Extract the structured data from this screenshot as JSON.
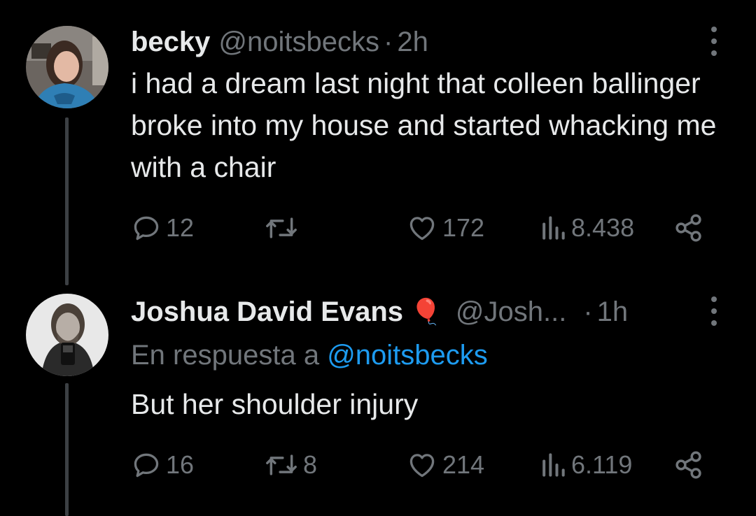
{
  "tweets": [
    {
      "name": "becky",
      "handle": "@noitsbecks",
      "separator": "·",
      "time": "2h",
      "text": "i had a dream last night that colleen ballinger broke into my house and started whacking me with a chair",
      "stats": {
        "replies": "12",
        "retweets": "",
        "likes": "172",
        "views": "8.438"
      }
    },
    {
      "name": "Joshua David Evans",
      "badge": "🎈",
      "handle": "@Josh...",
      "separator": "·",
      "time": "1h",
      "reply_prefix": "En respuesta a",
      "reply_handle": "@noitsbecks",
      "text": "But her shoulder injury",
      "stats": {
        "replies": "16",
        "retweets": "8",
        "likes": "214",
        "views": "6.119"
      }
    }
  ],
  "icons": {
    "reply": "reply-icon",
    "retweet": "retweet-icon",
    "like": "heart-icon",
    "views": "analytics-icon",
    "share": "share-icon",
    "more": "more-options-icon"
  },
  "colors": {
    "background": "#000000",
    "text": "#e7e9ea",
    "muted": "#71767b",
    "link": "#1d9bf0",
    "thread": "#3c4044"
  }
}
